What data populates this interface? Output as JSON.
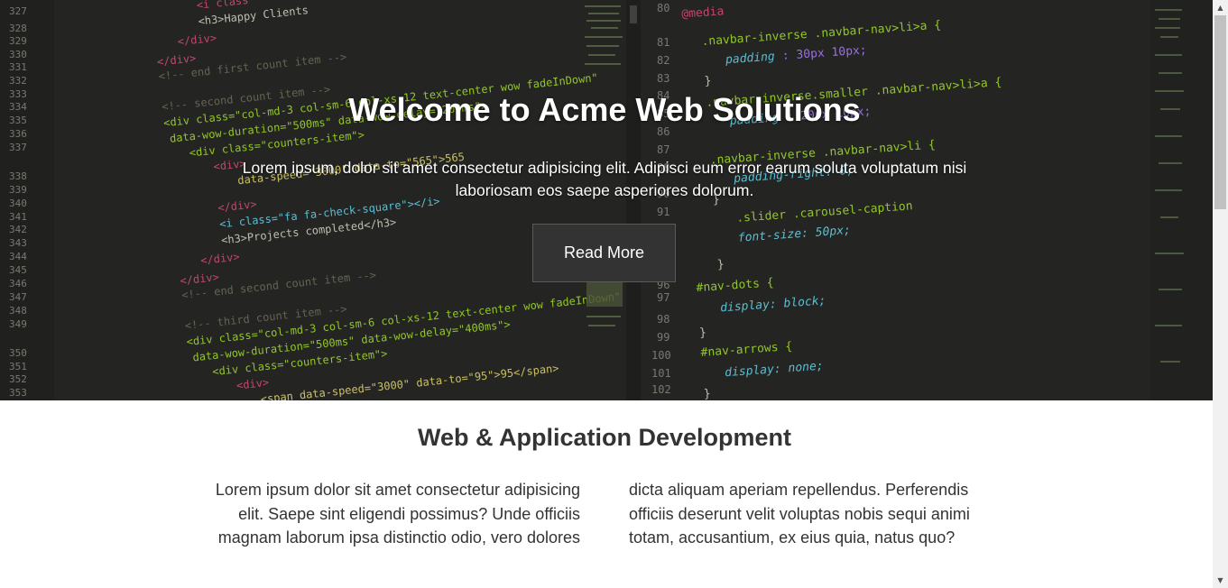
{
  "hero": {
    "title": "Welcome to Acme Web Solutions",
    "text": "Lorem ipsum, dolor sit amet consectetur adipisicing elit. Adipisci eum error earum soluta voluptatum nisi laboriosam eos saepe asperiores dolorum.",
    "button_label": "Read More",
    "background": "code-editor-image"
  },
  "section": {
    "title": "Web & Application Development",
    "col_left": "Lorem ipsum dolor sit amet consectetur adipisicing elit. Saepe sint eligendi possimus? Unde officiis magnam laborum ipsa distinctio odio, vero dolores",
    "col_right": "dicta aliquam aperiam repellendus. Perferendis officiis deserunt velit voluptas nobis sequi animi totam, accusantium, ex eius quia, natus quo?"
  },
  "scrollbar": {
    "up_icon": "chevron-up-icon",
    "down_icon": "chevron-down-icon"
  }
}
